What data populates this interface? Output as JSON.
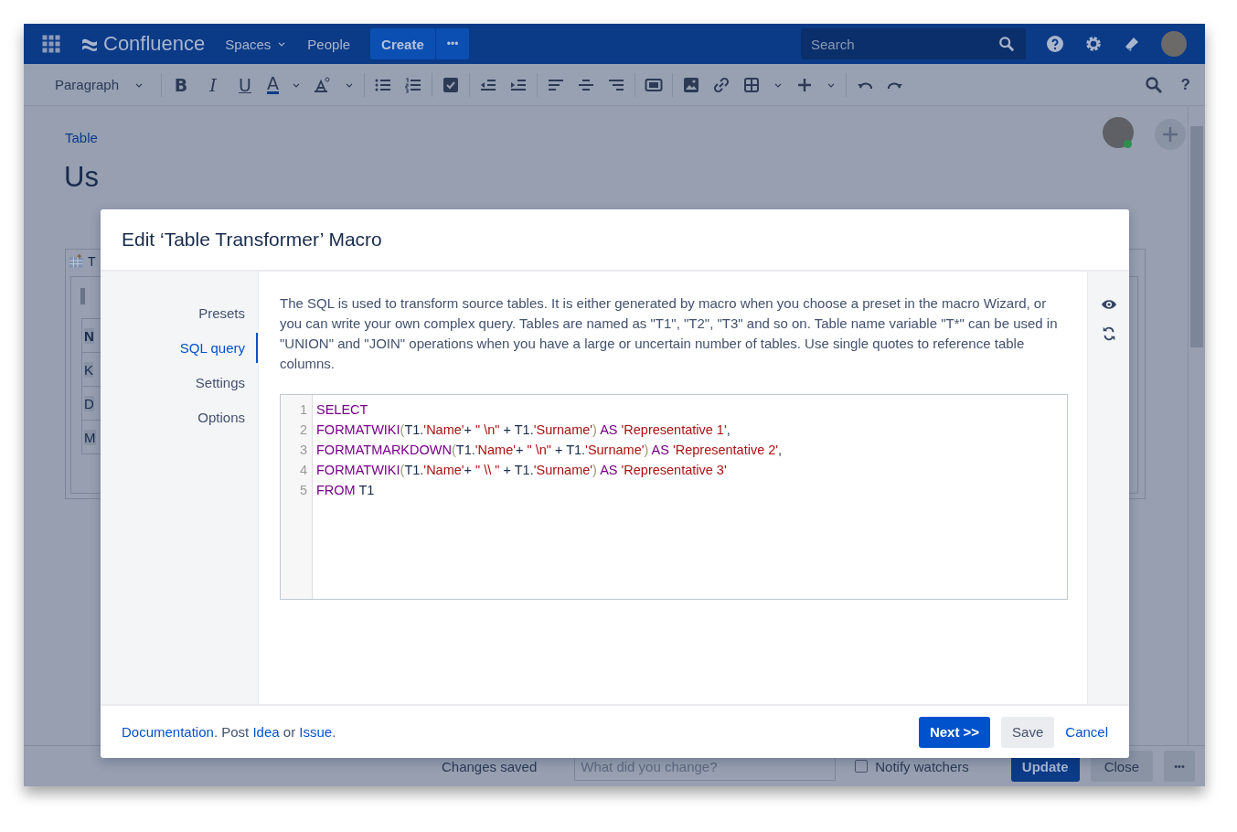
{
  "top_nav": {
    "app_name": "Confluence",
    "items": [
      {
        "label": "Spaces",
        "dropdown": true
      },
      {
        "label": "People",
        "dropdown": false
      }
    ],
    "create_button": "Create",
    "more_button": "•••",
    "search": {
      "placeholder": "Search"
    }
  },
  "editor_toolbar": {
    "paragraph_style": "Paragraph",
    "glyph_buttons": [
      "B",
      "I",
      "U",
      "A"
    ],
    "help": "?"
  },
  "page": {
    "breadcrumb": "Table",
    "title": "Us",
    "macro_label": "T",
    "table_cells": [
      {
        "text": "N",
        "bold": true
      },
      {
        "text": "K",
        "bold": false
      },
      {
        "text": "D",
        "bold": false
      },
      {
        "text": "M",
        "bold": false
      }
    ]
  },
  "dialog": {
    "title": "Edit ‘Table Transformer’ Macro",
    "nav": [
      {
        "label": "Presets",
        "selected": false
      },
      {
        "label": "SQL query",
        "selected": true
      },
      {
        "label": "Settings",
        "selected": false
      },
      {
        "label": "Options",
        "selected": false
      }
    ],
    "description": "The SQL is used to transform source tables. It is either generated by macro when you choose a preset in the macro Wizard, or you can write your own complex query. Tables are named as \"T1\", \"T2\", \"T3\" and so on. Table name variable \"T*\" can be used in \"UNION\" and \"JOIN\" operations when you have a large or uncertain number of tables. Use single quotes to reference table columns.",
    "code_lines": [
      {
        "number": "1",
        "tokens": [
          {
            "kind": "keyword",
            "text": "SELECT"
          }
        ]
      },
      {
        "number": "2",
        "tokens": [
          {
            "kind": "keyword",
            "text": "FORMATWIKI"
          },
          {
            "kind": "paren",
            "text": "("
          },
          {
            "kind": "plain",
            "text": "T1."
          },
          {
            "kind": "string",
            "text": "'Name'"
          },
          {
            "kind": "plain",
            "text": "+ "
          },
          {
            "kind": "string",
            "text": "\" \\n\""
          },
          {
            "kind": "plain",
            "text": " + T1."
          },
          {
            "kind": "string",
            "text": "'Surname'"
          },
          {
            "kind": "paren",
            "text": ")"
          },
          {
            "kind": "keyword",
            "text": " AS "
          },
          {
            "kind": "string",
            "text": "'Representative 1'"
          },
          {
            "kind": "plain",
            "text": ","
          }
        ]
      },
      {
        "number": "3",
        "tokens": [
          {
            "kind": "keyword",
            "text": "FORMATMARKDOWN"
          },
          {
            "kind": "paren",
            "text": "("
          },
          {
            "kind": "plain",
            "text": "T1."
          },
          {
            "kind": "string",
            "text": "'Name'"
          },
          {
            "kind": "plain",
            "text": "+ "
          },
          {
            "kind": "string",
            "text": "\" \\n\""
          },
          {
            "kind": "plain",
            "text": " + T1."
          },
          {
            "kind": "string",
            "text": "'Surname'"
          },
          {
            "kind": "paren",
            "text": ")"
          },
          {
            "kind": "keyword",
            "text": " AS "
          },
          {
            "kind": "string",
            "text": "'Representative 2'"
          },
          {
            "kind": "plain",
            "text": ","
          }
        ]
      },
      {
        "number": "4",
        "tokens": [
          {
            "kind": "keyword",
            "text": "FORMATWIKI"
          },
          {
            "kind": "paren",
            "text": "("
          },
          {
            "kind": "plain",
            "text": "T1."
          },
          {
            "kind": "string",
            "text": "'Name'"
          },
          {
            "kind": "plain",
            "text": "+ "
          },
          {
            "kind": "string",
            "text": "\" \\\\ \""
          },
          {
            "kind": "plain",
            "text": " + T1."
          },
          {
            "kind": "string",
            "text": "'Surname'"
          },
          {
            "kind": "paren",
            "text": ")"
          },
          {
            "kind": "keyword",
            "text": " AS "
          },
          {
            "kind": "string",
            "text": "'Representative 3'"
          }
        ]
      },
      {
        "number": "5",
        "tokens": [
          {
            "kind": "keyword",
            "text": "FROM"
          },
          {
            "kind": "plain",
            "text": " T1"
          }
        ]
      }
    ],
    "footer_note": [
      {
        "kind": "link",
        "text": "Documentation"
      },
      {
        "kind": "text",
        "text": ". Post "
      },
      {
        "kind": "link",
        "text": "Idea"
      },
      {
        "kind": "text",
        "text": " or "
      },
      {
        "kind": "link",
        "text": "Issue"
      },
      {
        "kind": "text",
        "text": "."
      }
    ],
    "buttons": [
      {
        "label": "Next >>",
        "kind": "primary"
      },
      {
        "label": "Save",
        "kind": "default"
      },
      {
        "label": "Cancel",
        "kind": "link"
      }
    ]
  },
  "bottom_bar": {
    "status": "Changes saved",
    "comment": {
      "placeholder": "What did you change?"
    },
    "notify": {
      "label": "Notify watchers",
      "checked": false
    },
    "update_button": "Update",
    "close_button": "Close",
    "more_button": "•••"
  }
}
